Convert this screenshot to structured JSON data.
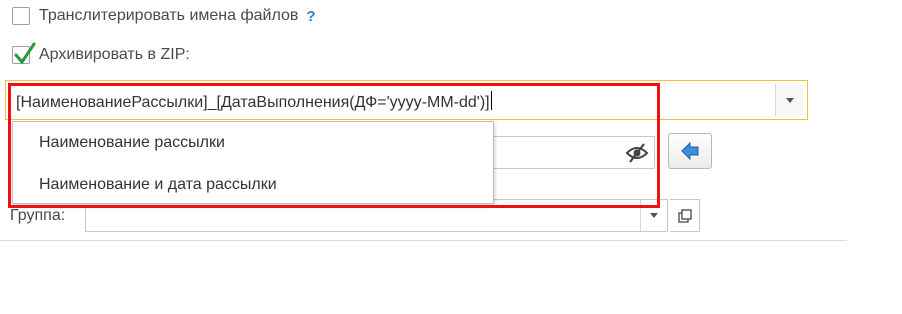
{
  "transliterate": {
    "label": "Транслитерировать имена файлов",
    "help": "?",
    "checked": false
  },
  "archive": {
    "label": "Архивировать в ZIP:",
    "checked": true
  },
  "template_field": {
    "value": "[НаименованиеРассылки]_[ДатаВыполнения(ДФ='yyyy-MM-dd')]",
    "dropdown_icon": "triangle-down-icon"
  },
  "template_options": [
    "Наименование рассылки",
    "Наименование и дата рассылки"
  ],
  "group": {
    "label": "Группа:",
    "value": ""
  },
  "icons": {
    "password_toggle": "eye-crossed-icon",
    "back_button": "arrow-left-icon",
    "open_button": "open-window-icon"
  },
  "colors": {
    "accent": "#2f7fcf",
    "checkmark": "#1e9e3a",
    "focus_border": "#f0c040",
    "highlight": "#ee1111"
  }
}
